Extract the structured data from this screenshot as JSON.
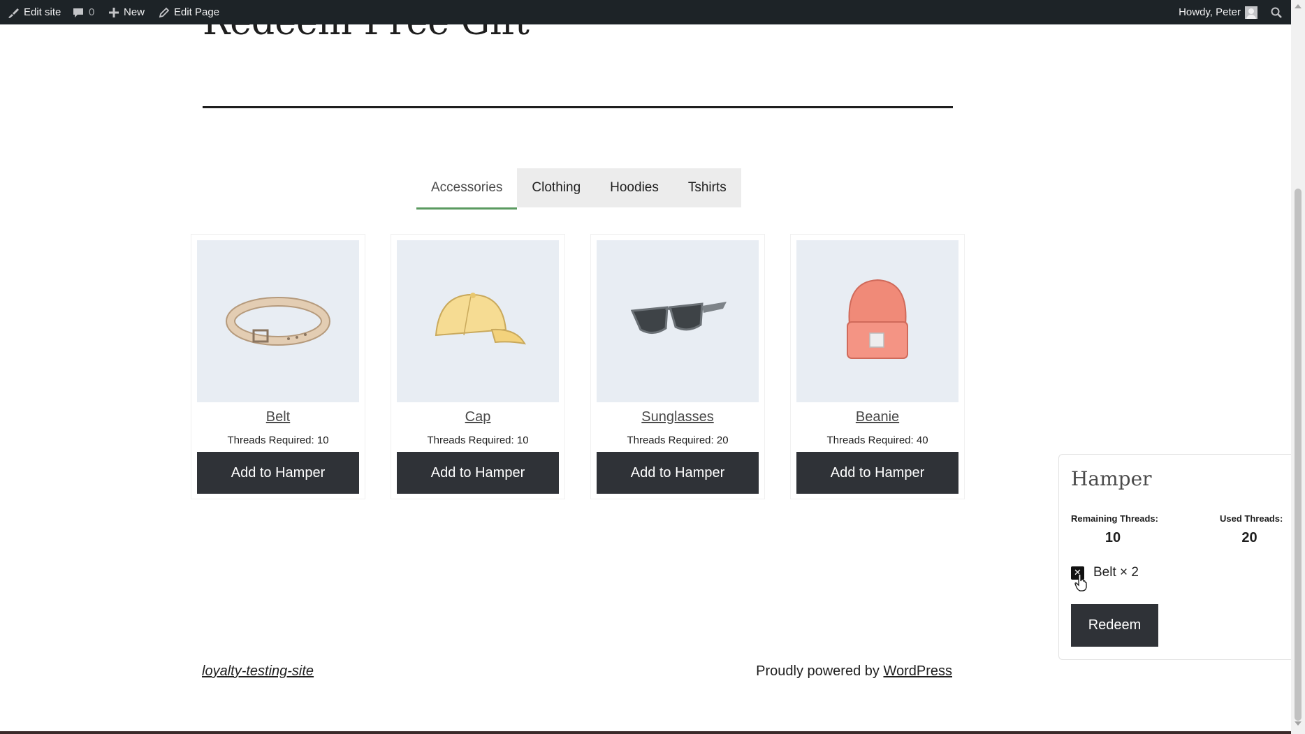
{
  "admin_bar": {
    "edit_site": "Edit site",
    "comments_count": "0",
    "new": "New",
    "edit_page": "Edit Page",
    "howdy": "Howdy, Peter"
  },
  "page": {
    "title": "Redeem Free Gift"
  },
  "tabs": [
    {
      "label": "Accessories",
      "active": true
    },
    {
      "label": "Clothing",
      "active": false
    },
    {
      "label": "Hoodies",
      "active": false
    },
    {
      "label": "Tshirts",
      "active": false
    }
  ],
  "products": [
    {
      "name": "Belt",
      "threads": "Threads Required: 10",
      "button": "Add to Hamper",
      "icon": "belt-icon"
    },
    {
      "name": "Cap",
      "threads": "Threads Required: 10",
      "button": "Add to Hamper",
      "icon": "cap-icon"
    },
    {
      "name": "Sunglasses",
      "threads": "Threads Required: 20",
      "button": "Add to Hamper",
      "icon": "sunglasses-icon"
    },
    {
      "name": "Beanie",
      "threads": "Threads Required: 40",
      "button": "Add to Hamper",
      "icon": "beanie-icon"
    }
  ],
  "hamper": {
    "title": "Hamper",
    "remaining_label": "Remaining Threads:",
    "remaining_value": "10",
    "used_label": "Used Threads:",
    "used_value": "20",
    "items": [
      {
        "label": "Belt × 2"
      }
    ],
    "remove_glyph": "✕",
    "redeem": "Redeem"
  },
  "footer": {
    "site_name": "loyalty-testing-site",
    "powered_prefix": "Proudly powered by ",
    "powered_link": "WordPress"
  },
  "colors": {
    "admin_bar": "#1d2327",
    "button_dark": "#2f3237",
    "tab_active_underline": "#5a9a60",
    "product_bg": "#e8edf3"
  }
}
